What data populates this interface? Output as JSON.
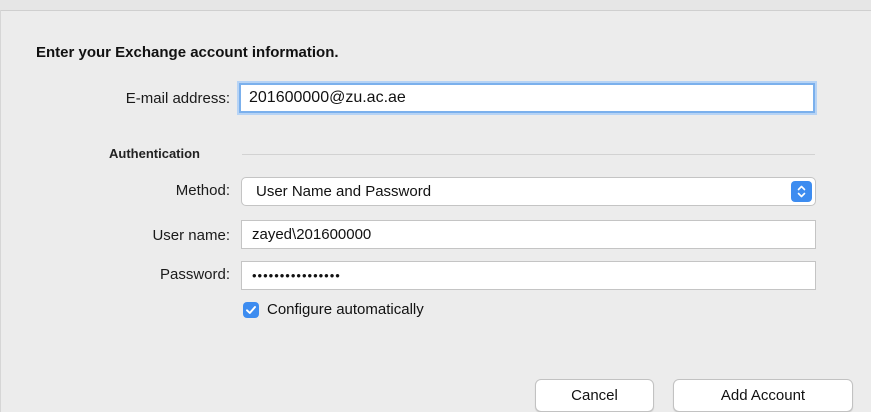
{
  "form": {
    "heading": "Enter your Exchange account information.",
    "email_label": "E-mail address:",
    "email_value": "201600000@zu.ac.ae",
    "auth_heading": "Authentication",
    "method_label": "Method:",
    "method_value": "User Name and Password",
    "username_label": "User name:",
    "username_value": "zayed\\201600000",
    "password_label": "Password:",
    "password_value": "••••••••••••••••",
    "configure_label": "Configure automatically",
    "configure_checked": true
  },
  "buttons": {
    "cancel": "Cancel",
    "add_account": "Add Account"
  },
  "icons": {
    "method_stepper": "chevron-up-down-icon",
    "checkbox": "checkmark-icon"
  },
  "colors": {
    "accent": "#3d8cf0",
    "focus_ring": "#7bb0ec"
  }
}
